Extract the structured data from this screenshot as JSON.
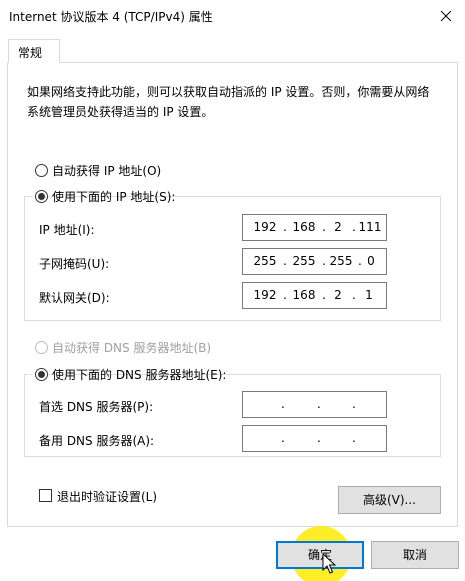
{
  "window": {
    "title": "Internet 协议版本 4 (TCP/IPv4) 属性",
    "close_icon": "close-icon"
  },
  "tabs": [
    {
      "label": "常规",
      "selected": true
    }
  ],
  "description": "如果网络支持此功能，则可以获取自动指派的 IP 设置。否则，你需要从网络系统管理员处获得适当的 IP 设置。",
  "ip_mode": {
    "auto_label": "自动获得 IP 地址(O)",
    "auto_checked": false,
    "manual_label": "使用下面的 IP 地址(S):",
    "manual_checked": true
  },
  "ip_fields": [
    {
      "label": "IP 地址(I):",
      "octets": [
        "192",
        "168",
        "2",
        "111"
      ]
    },
    {
      "label": "子网掩码(U):",
      "octets": [
        "255",
        "255",
        "255",
        "0"
      ]
    },
    {
      "label": "默认网关(D):",
      "octets": [
        "192",
        "168",
        "2",
        "1"
      ]
    }
  ],
  "dns_mode": {
    "auto_label": "自动获得 DNS 服务器地址(B)",
    "auto_checked": false,
    "auto_disabled": true,
    "manual_label": "使用下面的 DNS 服务器地址(E):",
    "manual_checked": true
  },
  "dns_fields": [
    {
      "label": "首选 DNS 服务器(P):",
      "octets": [
        "",
        "",
        "",
        ""
      ]
    },
    {
      "label": "备用 DNS 服务器(A):",
      "octets": [
        "",
        "",
        "",
        ""
      ]
    }
  ],
  "validate": {
    "label": "退出时验证设置(L)",
    "checked": false
  },
  "buttons": {
    "advanced": "高级(V)...",
    "ok": "确定",
    "cancel": "取消"
  },
  "colors": {
    "primary_border": "#0078d7",
    "button_face": "#e1e1e1",
    "cursor_highlight": "#ffeb00"
  }
}
